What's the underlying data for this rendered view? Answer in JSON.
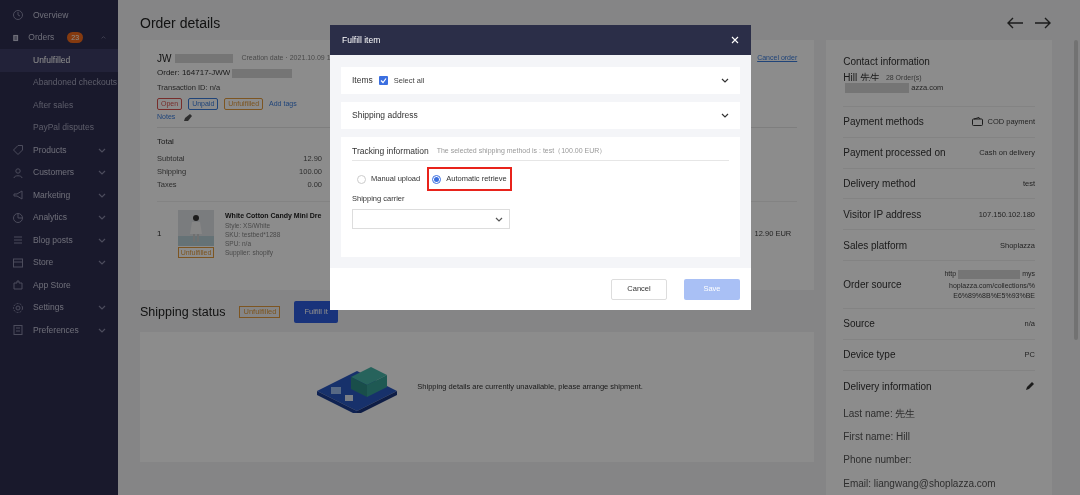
{
  "sidebar": {
    "items": [
      {
        "kind": "link",
        "label": "Overview"
      },
      {
        "kind": "group",
        "label": "Orders",
        "badge": "23",
        "expanded": true,
        "children": [
          {
            "label": "Unfulfilled",
            "selected": true
          },
          {
            "label": "Abandoned checkouts",
            "selected": false
          },
          {
            "label": "After sales",
            "selected": false
          },
          {
            "label": "PayPal disputes",
            "selected": false
          }
        ]
      },
      {
        "kind": "group",
        "label": "Products",
        "expanded": false
      },
      {
        "kind": "group",
        "label": "Customers",
        "expanded": false
      },
      {
        "kind": "group",
        "label": "Marketing",
        "expanded": false
      },
      {
        "kind": "group",
        "label": "Analytics",
        "expanded": false
      },
      {
        "kind": "group",
        "label": "Blog posts",
        "expanded": false
      },
      {
        "kind": "group",
        "label": "Store",
        "expanded": false
      },
      {
        "kind": "link",
        "label": "App Store"
      },
      {
        "kind": "group",
        "label": "Settings",
        "expanded": false
      },
      {
        "kind": "group",
        "label": "Preferences",
        "expanded": false
      }
    ]
  },
  "page": {
    "title": "Order details"
  },
  "order": {
    "name_prefix": "JW",
    "creation_date": "Creation date · 2021.10.09 1",
    "order_number": "Order: 164717-JWW",
    "transaction": "Transaction ID: n/a",
    "tags": [
      {
        "label": "Open",
        "kind": "order"
      },
      {
        "label": "Unpaid",
        "kind": "payment"
      },
      {
        "label": "Unfulfilled",
        "kind": "fulfillment"
      }
    ],
    "add_tags": "Add tags",
    "notes": "Notes",
    "cancel_order": "Cancel order",
    "total": {
      "title": "Total",
      "rows": [
        {
          "label": "Subtotal",
          "value": "12.90"
        },
        {
          "label": "Shipping",
          "value": "100.00"
        },
        {
          "label": "Taxes",
          "value": "0.00"
        }
      ]
    },
    "line_item": {
      "quantity": "1",
      "status": "Unfulfilled",
      "title": "White Cotton Candy Mini Dre",
      "details": [
        "Style: XS/White",
        "SKU: testbed*1288",
        "SPU: n/a",
        "Supplier: shopify"
      ],
      "price": "12.90 EUR"
    }
  },
  "shipping": {
    "title": "Shipping status",
    "status": "Unfulfilled",
    "button": "Fulfill it",
    "message": "Shipping details are currently unavailable, please arrange shipment."
  },
  "customer": {
    "title": "Contact information",
    "name": "Hill 先生",
    "orders": "28 Order(s)",
    "email_tail": "azza.com",
    "rows": [
      {
        "kind": "payment",
        "label": "Payment methods",
        "value": "COD payment"
      },
      {
        "kind": "text",
        "label": "Payment processed on",
        "value": "Cash on delivery"
      },
      {
        "kind": "text",
        "label": "Delivery method",
        "value": "test"
      },
      {
        "kind": "text",
        "label": "Visitor IP address",
        "value": "107.150.102.180"
      },
      {
        "kind": "text",
        "label": "Sales platform",
        "value": "Shoplazza"
      },
      {
        "kind": "link",
        "label": "Order source",
        "lines": [
          "http",
          "mys",
          "hoplazza.com/collections/%",
          "E6%89%8B%E5%93%BE"
        ]
      },
      {
        "kind": "text",
        "label": "Source",
        "value": "n/a"
      },
      {
        "kind": "text",
        "label": "Device type",
        "value": "PC"
      }
    ],
    "delivery": {
      "title": "Delivery information",
      "fields": [
        "Last name: 先生",
        "First name: Hill",
        "Phone number:",
        "Email: liangwang@shoplazza.com"
      ]
    }
  },
  "modal": {
    "title": "Fulfill item",
    "items": {
      "title": "Items",
      "select_all": {
        "label": "Select all",
        "checked": true
      },
      "expanded": false
    },
    "address": {
      "title": "Shipping address",
      "expanded": false
    },
    "tracking": {
      "title": "Tracking information",
      "note": "The selected shipping method is : test（100.00 EUR）",
      "methods": [
        {
          "label": "Manual upload",
          "selected": false,
          "highlighted": false
        },
        {
          "label": "Automatic retrieve",
          "selected": true,
          "highlighted": true
        }
      ],
      "carrier_label": "Shipping carrier"
    },
    "cancel": "Cancel",
    "save": {
      "label": "Save",
      "disabled": true
    }
  }
}
